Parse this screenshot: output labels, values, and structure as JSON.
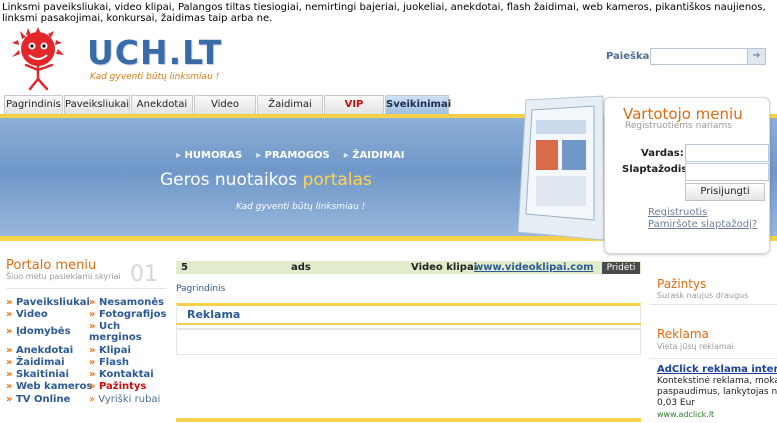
{
  "topline": "Linksmi paveiksliukai, video klipai, Palangos tiltas tiesiogiai, nemirtingi bajeriai, juokeliai, anekdotai, flash žaidimai, web kameros, pikantiškos naujienos, linksmi pasakojimai, konkursai, žaidimas taip arba ne.",
  "logo": {
    "text": "UCH.LT",
    "slogan": "Kad gyventi būtų linksmiau !"
  },
  "search": {
    "label": "Paieška:",
    "value": "",
    "button_icon": "arrow-right-icon"
  },
  "tabs": [
    {
      "label": "Pagrindinis"
    },
    {
      "label": "Paveiksliukai"
    },
    {
      "label": "Anekdotai"
    },
    {
      "label": "Video"
    },
    {
      "label": "Žaidimai"
    },
    {
      "label": "VIP"
    },
    {
      "label": "Sveikinimai"
    }
  ],
  "banner": {
    "nav": [
      "HUMORAS",
      "PRAMOGOS",
      "ŽAIDIMAI"
    ],
    "title_main": "Geros nuotaikos",
    "title_highlight": "portalas",
    "slogan": "Kad gyventi būtų linksmiau !"
  },
  "login": {
    "title": "Vartotojo meniu",
    "subtitle": "Registruotiems nariams",
    "username_label": "Vardas:",
    "password_label": "Slaptažodis:",
    "button": "Prisijungti",
    "register_link": "Registruotis",
    "forgot_link": "Pamiršote slaptažodį?"
  },
  "portal_menu": {
    "title": "Portalo meniu",
    "subtitle": "Šiuo metu pasiekiami skyriai",
    "number": "01",
    "left": [
      "Paveiksliukai",
      "Video",
      "Įdomybės",
      "Anekdotai",
      "Žaidimai",
      "Skaitiniai",
      "Web kameros",
      "TV Online"
    ],
    "right": [
      "Nesamonės",
      "Fotografijos",
      "Uch merginos",
      "Klipai",
      "Flash",
      "Kontaktai",
      "Pažintys",
      "Vyriški rubai"
    ]
  },
  "feed": {
    "number": "5",
    "ads": "ads",
    "label": "Video klipai",
    "url": "www.videoklipai.com",
    "button": "Pridėti"
  },
  "breadcrumb": "Pagrindinis",
  "center_panel": {
    "title": "Reklama"
  },
  "right_col": {
    "pazintys_title": "Pažintys",
    "pazintys_sub": "Surask naujus draugus",
    "reklama_title": "Reklama",
    "reklama_sub": "Vieta jūsų reklamai",
    "ad_title": "AdClick reklama internete",
    "ad_lines": [
      "Kontekstinė reklama, mokat",
      "paspaudimus, lankytojas nu",
      "0,03 Eur"
    ],
    "ad_url": "www.adclick.lt"
  },
  "colors": {
    "accent": "#e06a10",
    "link": "#2b5a96",
    "banner": "#6f97c8",
    "highlight": "#f6d049"
  }
}
